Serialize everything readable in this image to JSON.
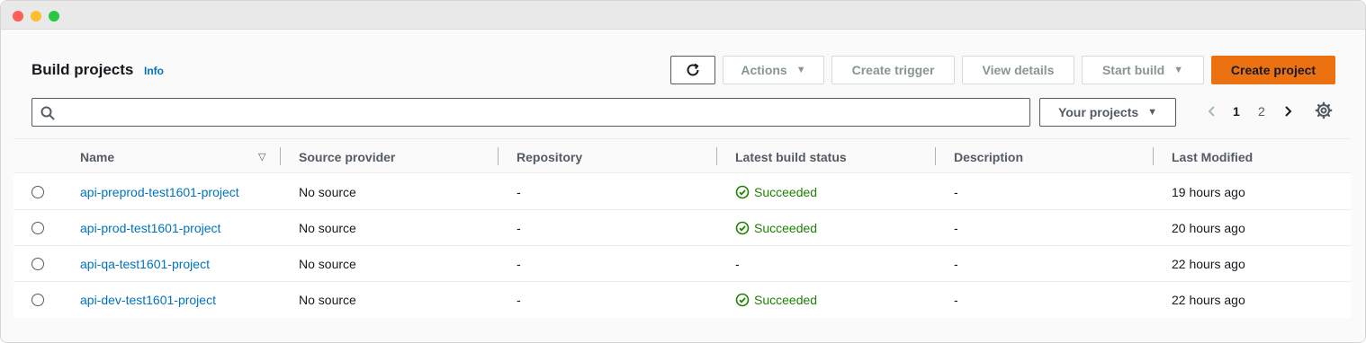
{
  "page": {
    "title": "Build projects",
    "info_label": "Info"
  },
  "toolbar": {
    "actions_label": "Actions",
    "create_trigger_label": "Create trigger",
    "view_details_label": "View details",
    "start_build_label": "Start build",
    "create_project_label": "Create project"
  },
  "search": {
    "placeholder": ""
  },
  "filter": {
    "selected": "Your projects"
  },
  "pagination": {
    "current": "1",
    "page2": "2"
  },
  "table": {
    "columns": [
      "Name",
      "Source provider",
      "Repository",
      "Latest build status",
      "Description",
      "Last Modified"
    ],
    "rows": [
      {
        "name": "api-preprod-test1601-project",
        "source": "No source",
        "repository": "-",
        "status": "Succeeded",
        "description": "-",
        "modified": "19 hours ago"
      },
      {
        "name": "api-prod-test1601-project",
        "source": "No source",
        "repository": "-",
        "status": "Succeeded",
        "description": "-",
        "modified": "20 hours ago"
      },
      {
        "name": "api-qa-test1601-project",
        "source": "No source",
        "repository": "-",
        "status": "-",
        "description": "-",
        "modified": "22 hours ago"
      },
      {
        "name": "api-dev-test1601-project",
        "source": "No source",
        "repository": "-",
        "status": "Succeeded",
        "description": "-",
        "modified": "22 hours ago"
      }
    ]
  },
  "colors": {
    "primary": "#ec7211",
    "link": "#0073bb",
    "success": "#1d8102"
  }
}
